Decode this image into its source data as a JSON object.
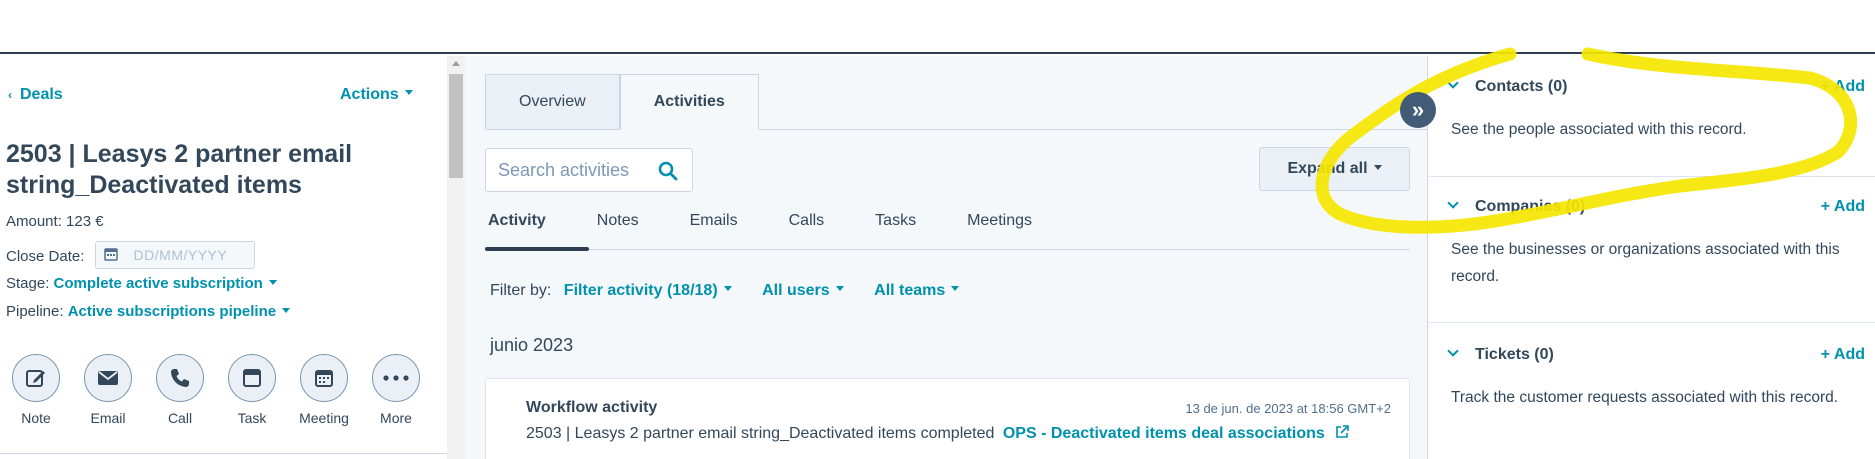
{
  "left": {
    "back_label": "Deals",
    "actions_label": "Actions",
    "title": "2503 | Leasys 2 partner email string_Deactivated items",
    "amount_label": "Amount:",
    "amount_value": "123 €",
    "close_date_label": "Close Date:",
    "close_date_placeholder": "DD/MM/YYYY",
    "stage_label": "Stage:",
    "stage_value": "Complete active subscription",
    "pipeline_label": "Pipeline:",
    "pipeline_value": "Active subscriptions pipeline",
    "action_buttons": [
      {
        "label": "Note",
        "icon": "note-edit-icon"
      },
      {
        "label": "Email",
        "icon": "envelope-icon"
      },
      {
        "label": "Call",
        "icon": "phone-icon"
      },
      {
        "label": "Task",
        "icon": "task-icon"
      },
      {
        "label": "Meeting",
        "icon": "calendar-icon"
      },
      {
        "label": "More",
        "icon": "more-dots-icon"
      }
    ]
  },
  "middle": {
    "tabs": [
      {
        "label": "Overview",
        "active": false
      },
      {
        "label": "Activities",
        "active": true
      }
    ],
    "search_placeholder": "Search activities",
    "expand_all_label": "Expand all",
    "subtabs": [
      "Activity",
      "Notes",
      "Emails",
      "Calls",
      "Tasks",
      "Meetings"
    ],
    "active_subtab": "Activity",
    "filter_by_label": "Filter by:",
    "filter_activity": "Filter activity (18/18)",
    "filter_users": "All users",
    "filter_teams": "All teams",
    "month_heading": "junio 2023",
    "activity": {
      "title": "Workflow activity",
      "timestamp": "13 de jun. de 2023 at 18:56 GMT+2",
      "body": "2503 | Leasys 2 partner email string_Deactivated items completed",
      "workflow_link": "OPS - Deactivated items deal associations"
    }
  },
  "right": {
    "sections": [
      {
        "title": "Contacts (0)",
        "add_label": "+ Add",
        "description": "See the people associated with this record."
      },
      {
        "title": "Companies (0)",
        "add_label": "+ Add",
        "description": "See the businesses or organizations associated with this record."
      },
      {
        "title": "Tickets (0)",
        "add_label": "+ Add",
        "description": "Track the customer requests associated with this record."
      }
    ]
  },
  "toggle_icon": "double-chevron-right-icon",
  "colors": {
    "accent": "#0091ae",
    "text": "#33475b",
    "highlight": "#f5e600"
  }
}
